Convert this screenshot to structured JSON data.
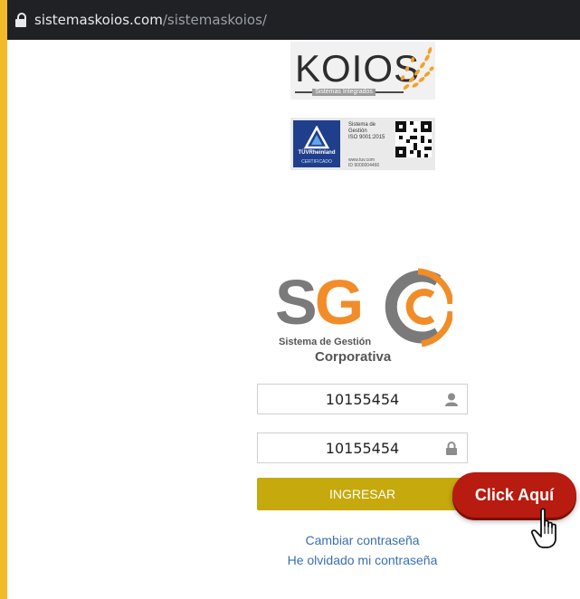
{
  "browser": {
    "url_host": "sistemaskoios.com",
    "url_path": "/sistemaskoios/"
  },
  "koios_logo": {
    "name": "KOIOS",
    "subtitle": "Sistemas Integrados"
  },
  "certification_badge": {
    "brand": "TÜVRheinland",
    "label": "CERTIFICADO",
    "text_lines": [
      "Sistema de",
      "Gestión",
      "ISO 9001:2015"
    ],
    "small_lines": [
      "www.tuv.com",
      "ID 9000004466"
    ]
  },
  "sgc_logo": {
    "letters_s": "S",
    "letters_g": "G",
    "line1": "Sistema de Gestión",
    "line2": "Corporativa"
  },
  "login": {
    "username_value": "10155454",
    "password_value": "10155454",
    "username_icon": "user-icon",
    "password_icon": "lock-icon",
    "submit_label": "INGRESAR"
  },
  "callout": {
    "label": "Click Aquí",
    "icon": "hand-pointer-icon"
  },
  "links": {
    "change_password": "Cambiar contraseña",
    "forgot_password": "He olvidado mi contraseña"
  },
  "colors": {
    "frame": "#f2b928",
    "submit_button": "#c6a90d",
    "callout": "#b81b0f",
    "link": "#3a6fb0",
    "sgc_orange": "#f28c28",
    "sgc_gray": "#7a7a7a"
  }
}
